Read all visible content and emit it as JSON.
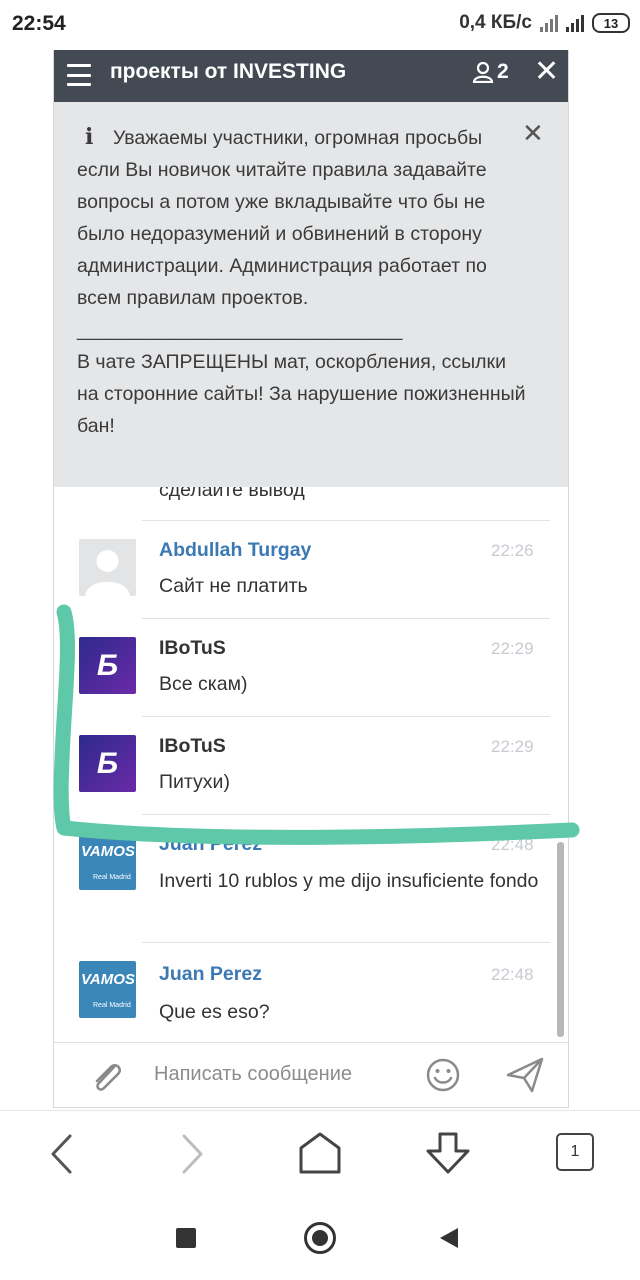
{
  "status_bar": {
    "time": "22:54",
    "speed": "0,4 КБ/с",
    "battery": "13"
  },
  "header": {
    "title": "проекты от INVESTING",
    "user_count": "2"
  },
  "notice": {
    "text": "Уважаемы участники, огромная просьбы если Вы новичок читайте правила задавайте вопросы а потом уже вкладывайте что бы не было недоразумений и обвинений в сторону администрации. Администрация работает по всем правилам проектов.\n______________________________\nВ чате ЗАПРЕЩЕНЫ мат, оскорбления, ссылки на сторонние сайты! За нарушение пожизненный бан!"
  },
  "messages": [
    {
      "name": "",
      "time": "",
      "text": "сделайте вывод",
      "avatar": "none"
    },
    {
      "name": "Abdullah Turgay",
      "time": "22:26",
      "text": "Сайт не платить",
      "avatar": "default-user-icon",
      "name_color": "#3a79b4"
    },
    {
      "name": "IBoTuS",
      "time": "22:29",
      "text": "Все скам)",
      "avatar": "b-letter-icon",
      "name_color": "#333333"
    },
    {
      "name": "IBoTuS",
      "time": "22:29",
      "text": "Питухи)",
      "avatar": "b-letter-icon",
      "name_color": "#333333"
    },
    {
      "name": "Juan Perez",
      "time": "22:48",
      "text": "Inverti 10 rublos y me dijo insuficiente fondo",
      "avatar": "vamos-badge-icon",
      "name_color": "#3a79b4"
    },
    {
      "name": "Juan Perez",
      "time": "22:48",
      "text": "Que es eso?",
      "avatar": "vamos-badge-icon",
      "name_color": "#3a79b4"
    }
  ],
  "avatar_text": {
    "b_letter": "Б",
    "vamos": "VAMOS",
    "vamos_sub": "Real Madrid"
  },
  "composer": {
    "placeholder": "Написать сообщение"
  },
  "browser": {
    "tab_count": "1"
  },
  "colors": {
    "header_bg": "#434a54",
    "notice_bg": "#e5e6e8",
    "link_name": "#3a79b4",
    "highlight": "#5ec8a8"
  }
}
